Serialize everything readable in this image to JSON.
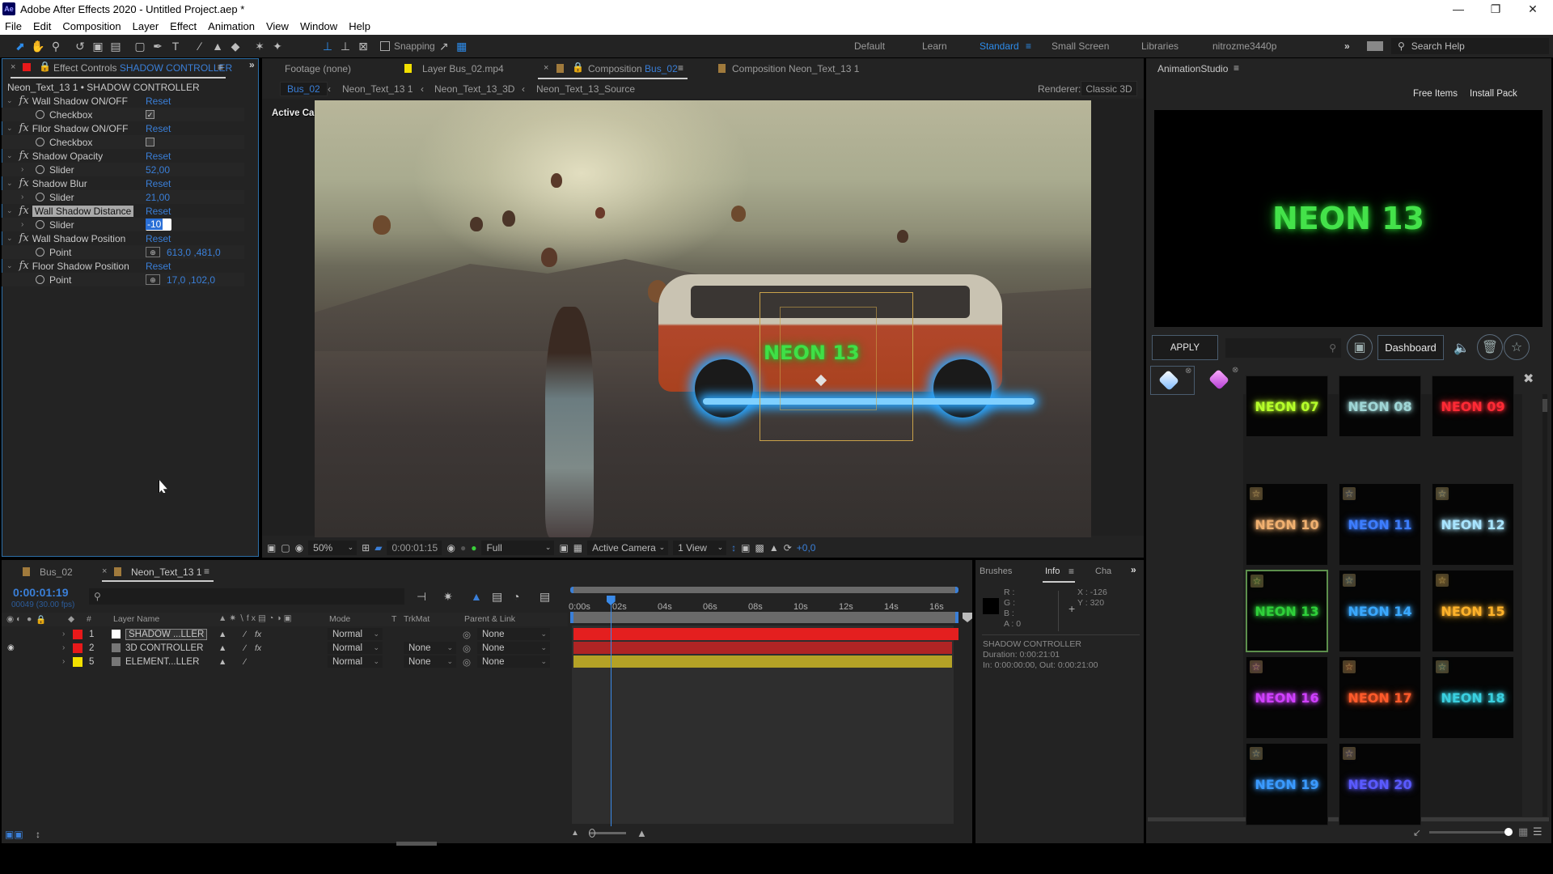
{
  "window": {
    "title": "Adobe After Effects 2020 - Untitled Project.aep *",
    "app_icon_label": "Ae",
    "controls": [
      "minimize-icon",
      "restore-icon",
      "close-icon"
    ]
  },
  "menu": [
    "File",
    "Edit",
    "Composition",
    "Layer",
    "Effect",
    "Animation",
    "View",
    "Window",
    "Help"
  ],
  "toolbar": {
    "snapping_label": "Snapping",
    "snapping_checked": false,
    "workspaces": [
      "Default",
      "Learn",
      "Standard",
      "Small Screen",
      "Libraries",
      "nitrozme3440p"
    ],
    "active_workspace": "Standard",
    "search_help_placeholder": "Search Help"
  },
  "effect_controls": {
    "tab_label": "Effect Controls",
    "tab_layer": "SHADOW CONTROLLER",
    "header": "Neon_Text_13 1 • SHADOW CONTROLLER",
    "reset_label": "Reset",
    "effects": [
      {
        "name": "Wall Shadow ON/OFF",
        "param": "Checkbox",
        "value": "checked"
      },
      {
        "name": "Fllor Shadow ON/OFF",
        "param": "Checkbox",
        "value": "unchecked"
      },
      {
        "name": "Shadow Opacity",
        "param": "Slider",
        "value": "52,00"
      },
      {
        "name": "Shadow Blur",
        "param": "Slider",
        "value": "21,00"
      },
      {
        "name": "Wall Shadow Distance",
        "param": "Slider",
        "value": "-10",
        "editing": true
      },
      {
        "name": "Wall Shadow Position",
        "param": "Point",
        "value": "613,0 ,481,0"
      },
      {
        "name": "Floor Shadow Position",
        "param": "Point",
        "value": "17,0 ,102,0"
      }
    ]
  },
  "viewer": {
    "tabs": [
      {
        "label": "Footage (none)",
        "color": null
      },
      {
        "label": "Layer Bus_02.mp4",
        "color": "#f2e000"
      },
      {
        "label_prefix": "Composition",
        "label_name": "Bus_02",
        "color": "#a07a3c",
        "active": true
      },
      {
        "label": "Composition Neon_Text_13 1",
        "color": "#a07a3c"
      }
    ],
    "breadcrumbs": [
      "Bus_02",
      "Neon_Text_13 1",
      "Neon_Text_13_3D",
      "Neon_Text_13_Source"
    ],
    "renderer_label": "Renderer:",
    "renderer_value": "Classic 3D",
    "camera_overlay": "Active Camera",
    "comp_text": "NEON 13",
    "bottom": {
      "zoom": "50%",
      "timecode": "0:00:01:15",
      "resolution": "Full",
      "camera": "Active Camera",
      "views": "1 View",
      "exposure": "+0,0"
    }
  },
  "animation_studio": {
    "title": "AnimationStudio",
    "links": [
      "Free Items",
      "Install Pack"
    ],
    "preview_text": "NEON 13",
    "apply_label": "APPLY",
    "search_placeholder": "",
    "dashboard_label": "Dashboard",
    "presets": [
      {
        "label": "NEON 07",
        "color": "#b6ff2a",
        "star": false
      },
      {
        "label": "NEON 08",
        "color": "#9fd6d6",
        "star": false
      },
      {
        "label": "NEON 09",
        "color": "#ff2a35",
        "star": false
      },
      {
        "label": "NEON 10",
        "color": "#f0b070",
        "star": true
      },
      {
        "label": "NEON 11",
        "color": "#3d7dff",
        "star": true
      },
      {
        "label": "NEON 12",
        "color": "#a8e4ff",
        "star": true
      },
      {
        "label": "NEON 13",
        "color": "#2fd13a",
        "star": true,
        "selected": true
      },
      {
        "label": "NEON 14",
        "color": "#3aa8ff",
        "star": true
      },
      {
        "label": "NEON 15",
        "color": "#ffb22a",
        "star": true
      },
      {
        "label": "NEON 16",
        "color": "#d040ff",
        "star": true
      },
      {
        "label": "NEON 17",
        "color": "#ff5a2a",
        "star": true
      },
      {
        "label": "NEON 18",
        "color": "#3ad0e0",
        "star": true
      },
      {
        "label": "NEON 19",
        "color": "#3a9aff",
        "star": true
      },
      {
        "label": "NEON 20",
        "color": "#5a5aff",
        "star": true
      }
    ],
    "thumb_size_percent": 98
  },
  "timeline": {
    "tabs": [
      {
        "label": "Bus_02",
        "color": "#a07a3c"
      },
      {
        "label": "Neon_Text_13 1",
        "color": "#a07a3c",
        "active": true
      }
    ],
    "current_time": "0:00:01:19",
    "frame_info": "00049 (30.00 fps)",
    "columns": {
      "layer_name": "Layer Name",
      "mode": "Mode",
      "t": "T",
      "trkmat": "TrkMat",
      "parent": "Parent & Link"
    },
    "layers": [
      {
        "num": "1",
        "name": "SHADOW ...LLER",
        "label_color": "#e8191a",
        "mode": "Normal",
        "trkmat": "",
        "parent": "None",
        "bar_color": "#e41f1f",
        "visible": false,
        "selected": true
      },
      {
        "num": "2",
        "name": "3D CONTROLLER",
        "label_color": "#e8191a",
        "mode": "Normal",
        "trkmat": "None",
        "parent": "None",
        "bar_color": "#b02424",
        "visible": true
      },
      {
        "num": "5",
        "name": "ELEMENT...LLER",
        "label_color": "#f2e000",
        "mode": "Normal",
        "trkmat": "None",
        "parent": "None",
        "bar_color": "#b4a226",
        "visible": false
      }
    ],
    "ruler": [
      "0:00s",
      "02s",
      "04s",
      "06s",
      "08s",
      "10s",
      "12s",
      "14s",
      "16s"
    ],
    "playhead_seconds": 1.63,
    "visible_range_seconds": 17
  },
  "info_panel": {
    "tabs": [
      "Brushes",
      "Info",
      "Cha"
    ],
    "active_tab": "Info",
    "r": "",
    "g": "",
    "b": "",
    "a": "0",
    "x": "-126",
    "y": "320",
    "layer": "SHADOW CONTROLLER",
    "duration": "Duration: 0:00:21:01",
    "in_out": "In: 0:00:00:00, Out: 0:00:21:00"
  }
}
